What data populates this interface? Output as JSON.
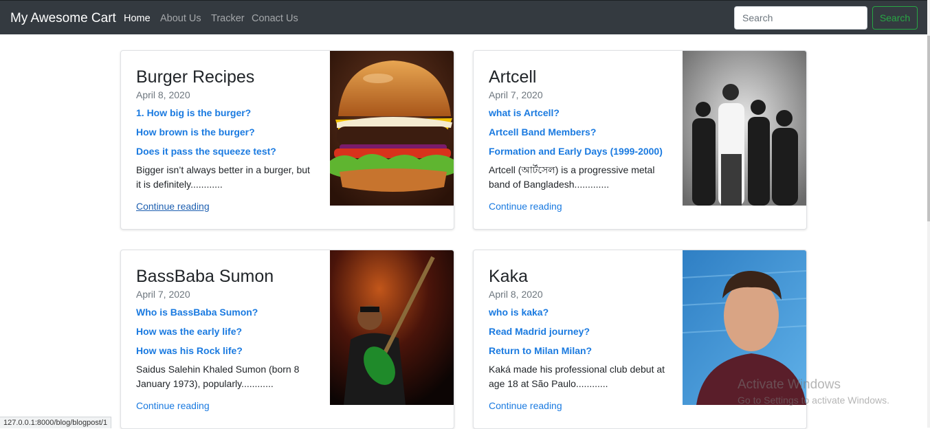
{
  "navbar": {
    "brand": "My Awesome Cart",
    "links": [
      "Home",
      "About Us",
      "Tracker",
      "Conact Us"
    ],
    "search_placeholder": "Search",
    "search_button": "Search",
    "bg_color": "#343a40"
  },
  "posts": [
    {
      "title": "Burger Recipes",
      "date": "April 8, 2020",
      "questions": [
        "1. How big is the burger?",
        "How brown is the burger?",
        "Does it pass the squeeze test?"
      ],
      "excerpt": "Bigger isn’t always better in a burger, but it is definitely............",
      "more": "Continue reading",
      "image": "burger-photo"
    },
    {
      "title": "Artcell",
      "date": "April 7, 2020",
      "questions": [
        "what is Artcell?",
        "Artcell Band Members?",
        "Formation and Early Days (1999-2000)"
      ],
      "excerpt": "Artcell (আর্টসেল) is a progressive metal band of Bangladesh.............",
      "more": "Continue reading",
      "image": "band-photo"
    },
    {
      "title": "BassBaba Sumon",
      "date": "April 7, 2020",
      "questions": [
        "Who is BassBaba Sumon?",
        "How was the early life?",
        "How was his Rock life?"
      ],
      "excerpt": "Saidus Salehin Khaled Sumon (born 8 January 1973), popularly............",
      "more": "Continue reading",
      "image": "guitarist-photo"
    },
    {
      "title": "Kaka",
      "date": "April 8, 2020",
      "questions": [
        "who is kaka?",
        "Read Madrid journey?",
        "Return to Milan Milan?"
      ],
      "excerpt": "Kaká made his professional club debut at age 18 at São Paulo............",
      "more": "Continue reading",
      "image": "footballer-photo"
    }
  ],
  "overlay": {
    "activate_title": "Activate Windows",
    "activate_sub": "Go to Settings to activate Windows.",
    "status_url": "127.0.0.1:8000/blog/blogpost/1"
  },
  "colors": {
    "link": "#1a7ae0",
    "search_green": "#28a745"
  }
}
